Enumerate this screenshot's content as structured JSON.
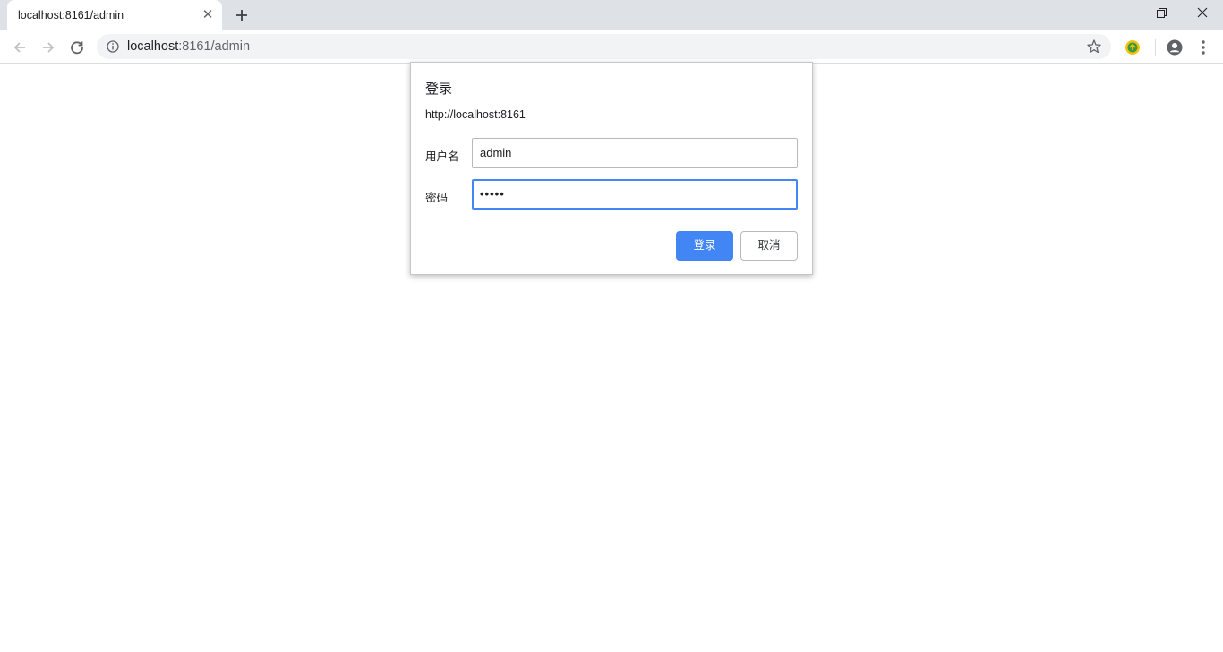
{
  "tab": {
    "title": "localhost:8161/admin",
    "close_glyph": "✕",
    "new_tab_icon": "plus-icon"
  },
  "window_controls": [
    "minimize-icon",
    "restore-icon",
    "close-icon"
  ],
  "toolbar": {
    "back_icon": "arrow-left-icon",
    "forward_icon": "arrow-right-icon",
    "reload_icon": "reload-icon",
    "omnibox": {
      "host": "localhost",
      "path": ":8161/admin",
      "info_icon": "info-icon",
      "bookmark_icon": "star-icon"
    },
    "extension_icon": "extension-icon",
    "profile_icon": "profile-icon",
    "menu_icon": "kebab-menu-icon"
  },
  "dialog": {
    "title": "登录",
    "origin": "http://localhost:8161",
    "username_label": "用户名",
    "username_value": "admin",
    "password_label": "密码",
    "password_masked": "•••••",
    "login_button": "登录",
    "cancel_button": "取消"
  },
  "colors": {
    "tabstrip_bg": "#dee1e6",
    "accent": "#4285f4",
    "omnibox_bg": "#f1f3f4"
  }
}
